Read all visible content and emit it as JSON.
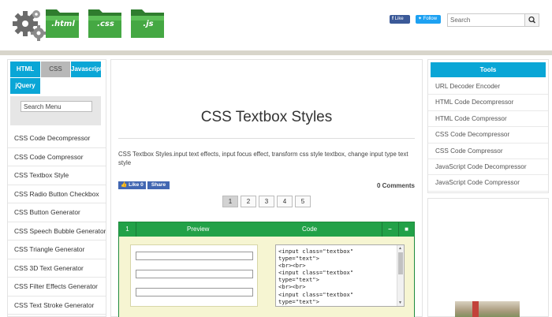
{
  "header": {
    "folders": [
      ".html",
      ".css",
      ".js"
    ],
    "social": {
      "fb_label": "Like",
      "tw_label": "Follow"
    },
    "search": {
      "placeholder": "Search",
      "icon": "magnifier-icon"
    },
    "colors": {
      "folder_green": "#3d9a3a",
      "band": "#d8d5cb"
    }
  },
  "left_sidebar": {
    "tabs": [
      "HTML",
      "CSS",
      "Javascript",
      "jQuery"
    ],
    "search_placeholder": "Search Menu",
    "items": [
      "CSS Code Decompressor",
      "CSS Code Compressor",
      "CSS Textbox Style",
      "CSS Radio Button Checkbox",
      "CSS Button Generator",
      "CSS Speech Bubble Generator",
      "CSS Triangle Generator",
      "CSS 3D Text Generator",
      "CSS Filter Effects Generator",
      "CSS Text Stroke Generator"
    ]
  },
  "main": {
    "title": "CSS Textbox Styles",
    "description": "CSS Textbox Styles.input text effects, input focus effect, transform css style textbox, change input type text style",
    "like_label": "Like 0",
    "share_label": "Share",
    "comments": "0 Comments",
    "pages": [
      "1",
      "2",
      "3",
      "4",
      "5"
    ],
    "active_page": "1",
    "panel": {
      "number": "1",
      "preview_label": "Preview",
      "code_label": "Code",
      "minimize": "–",
      "maximize": "■",
      "code": "<input class=\"textbox\"\ntype=\"text\">\n<br><br>\n<input class=\"textbox\"\ntype=\"text\">\n<br><br>\n<input class=\"textbox\"\ntype=\"text\">"
    }
  },
  "right_sidebar": {
    "heading": "Tools",
    "items": [
      "URL Decoder Encoder",
      "HTML Code Decompressor",
      "HTML Code Compressor",
      "CSS Code Decompressor",
      "CSS Code Compressor",
      "JavaScript Code Decompressor",
      "JavaScript Code Compressor"
    ]
  }
}
